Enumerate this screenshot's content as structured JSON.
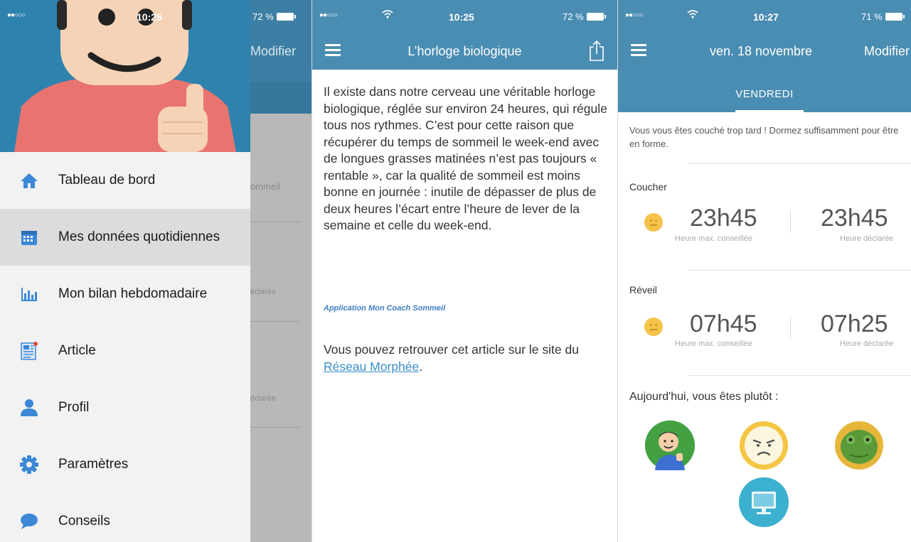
{
  "status_s1": {
    "signal": "●●○○○",
    "time": "10:25",
    "battery": "72 %"
  },
  "status_s2": {
    "signal": "●●○○○",
    "time": "10:25",
    "battery": "72 %"
  },
  "status_s3": {
    "signal": "●●○○○",
    "time": "10:27",
    "battery": "71 %"
  },
  "s1": {
    "modifier": "Modifier",
    "ghost_sommeil": "ommeil",
    "ghost_declare1": "éclarée",
    "ghost_declare2": "éclarée",
    "menu": [
      {
        "label": "Tableau de bord",
        "icon": "home-icon"
      },
      {
        "label": "Mes données quotidiennes",
        "icon": "calendar-icon"
      },
      {
        "label": "Mon bilan hebdomadaire",
        "icon": "bar-chart-icon"
      },
      {
        "label": "Article",
        "icon": "article-icon"
      },
      {
        "label": "Profil",
        "icon": "profile-icon"
      },
      {
        "label": "Paramètres",
        "icon": "settings-icon"
      },
      {
        "label": "Conseils",
        "icon": "chat-bubble-icon"
      }
    ],
    "active_index": 1
  },
  "s2": {
    "title": "L’horloge biologique",
    "body": "Il existe dans notre cerveau une véritable horloge biologique, réglée sur environ 24 heures, qui régule tous nos rythmes. C’est pour cette raison que récupérer du temps de sommeil le week-end avec de longues grasses matinées n’est pas toujours « rentable », car la qualité de sommeil est moins bonne en journée : inutile de dépasser de plus de deux heures l’écart entre l’heure de lever de la semaine et celle du week-end.",
    "source": "Application Mon Coach Sommeil",
    "more_text": "Vous pouvez retrouver cet article sur le site du ",
    "link_text": "Réseau Morphée",
    "after_link": "."
  },
  "s3": {
    "date": "ven. 18 novembre",
    "modifier": "Modifier",
    "day_tab": "VENDREDI",
    "advice": "Vous vous êtes couché trop tard ! Dormez suffisamment pour être en forme.",
    "coucher": {
      "title": "Coucher",
      "max": "23h45",
      "max_label": "Heure max. conseillée",
      "declared": "23h45",
      "declared_label": "Heure déclarée"
    },
    "reveil": {
      "title": "Réveil",
      "max": "07h45",
      "max_label": "Heure max. conseillée",
      "declared": "07h25",
      "declared_label": "Heure déclarée"
    },
    "question": "Aujourd'hui, vous êtes plutôt :"
  },
  "colors": {
    "nav_blue": "#4a8db2",
    "hero_blue": "#2e82ae",
    "smiley_yellow": "#f5c24a",
    "link_blue": "#3a8fc9"
  }
}
